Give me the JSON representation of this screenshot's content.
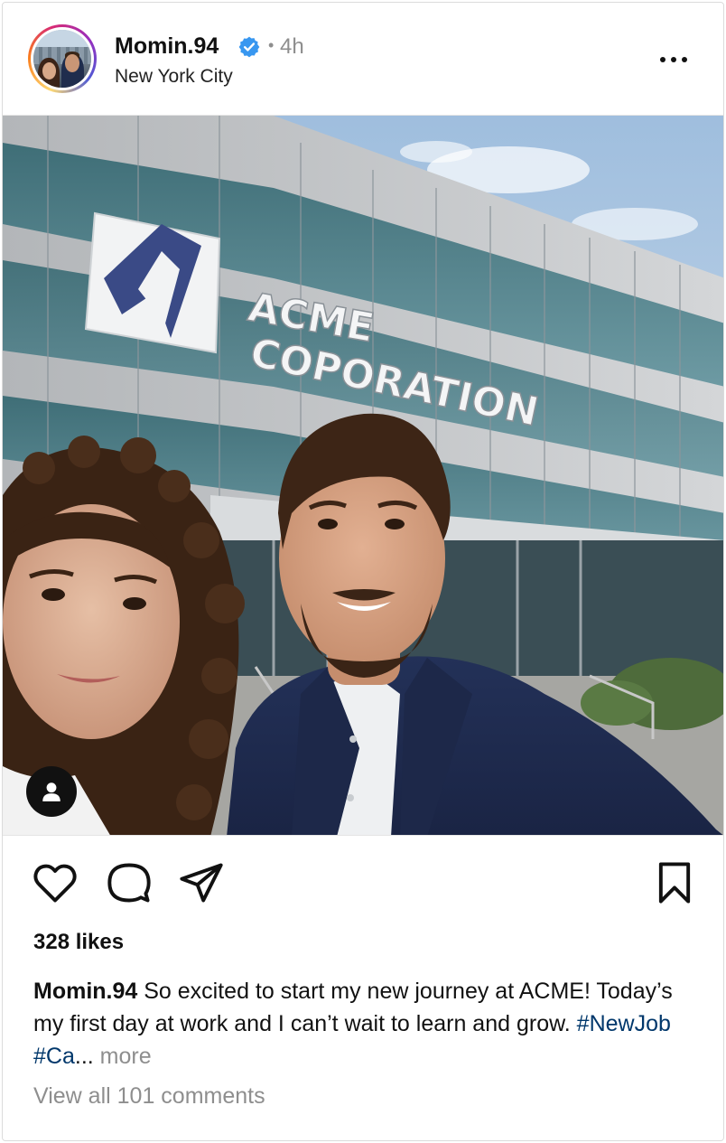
{
  "post": {
    "username": "Momin.94",
    "time_sep": "•",
    "time": "4h",
    "location": "New York City",
    "verified_icon": "verified-badge-icon",
    "verified_color": "#3897f0",
    "more_icon": "more-horizontal-icon"
  },
  "photo": {
    "sign_line1": "ACME",
    "sign_line2": "COPORATION",
    "tag_icon": "user-tag-icon"
  },
  "actions": {
    "like_icon": "heart-icon",
    "comment_icon": "comment-icon",
    "share_icon": "send-icon",
    "save_icon": "bookmark-icon"
  },
  "likes": "328 likes",
  "caption": {
    "username": "Momin.94",
    "text": " So excited to start my new journey at ACME! Today’s my first day at work and I can’t wait to learn and grow. ",
    "hashtag1": "#NewJob",
    "hashtag2": "#Ca",
    "ellipsis": "...",
    "more": " more"
  },
  "comments_link": "View all 101 comments",
  "colors": {
    "hashtag": "#00376b",
    "muted": "#8e8e8e"
  }
}
